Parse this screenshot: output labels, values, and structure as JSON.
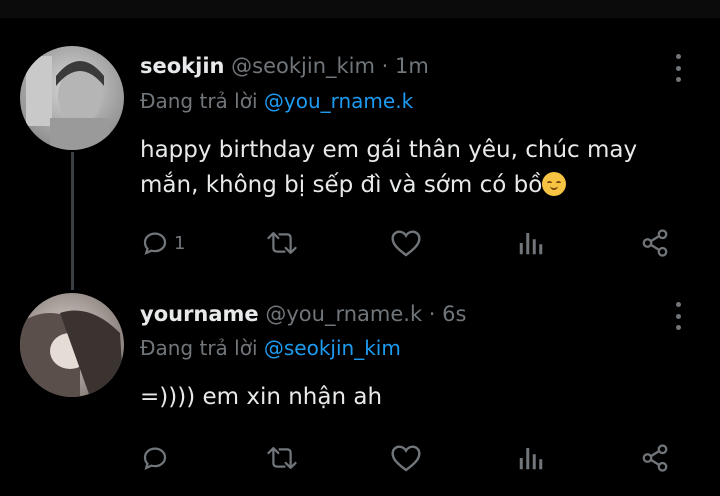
{
  "tweets": [
    {
      "name": "seokjin",
      "handle": "@seokjin_kim",
      "dot": "·",
      "time": "1m",
      "reply_prefix": "Đang trả lời",
      "reply_to": "@you_rname.k",
      "text_line1": "happy birthday em gái thân yêu, chúc may",
      "text_line2": "mắn, không bị sếp đì và sớm có bồ",
      "emoji": "relieved-face",
      "reply_count": "1",
      "avatar": "avatar-photo"
    },
    {
      "name": "yourname",
      "handle": "@you_rname.k",
      "dot": "·",
      "time": "6s",
      "reply_prefix": "Đang trả lời",
      "reply_to": "@seokjin_kim",
      "text_line1": "=)))) em xin nhận ah",
      "reply_count": "",
      "avatar": "avatar-photo"
    }
  ],
  "icons": [
    "reply-icon",
    "retweet-icon",
    "like-icon",
    "analytics-icon",
    "share-icon",
    "more-icon"
  ],
  "colors": {
    "background": "#000000",
    "text": "#e7e9ea",
    "muted": "#71767b",
    "mention": "#1d9bf0"
  }
}
